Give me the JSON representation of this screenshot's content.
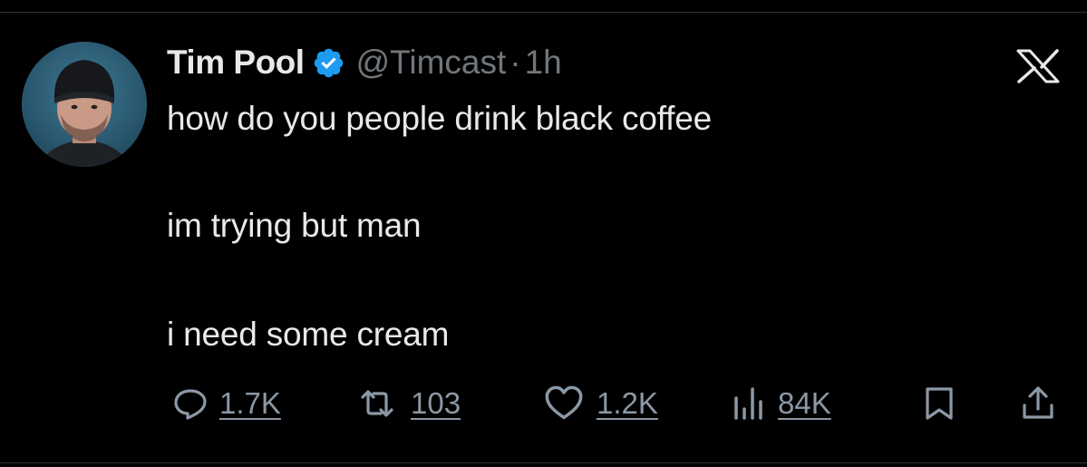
{
  "tweet": {
    "author_name": "Tim Pool",
    "handle": "@Timcast",
    "separator": "·",
    "time": "1h",
    "lines": [
      "how do you people drink black coffee",
      "im trying but man",
      "i need some cream"
    ]
  },
  "actions": {
    "replies": "1.7K",
    "reposts": "103",
    "likes": "1.2K",
    "views": "84K"
  },
  "icons": {
    "verified": "verified-badge-icon",
    "brand": "x-logo-icon",
    "reply": "reply-icon",
    "repost": "repost-icon",
    "like": "heart-icon",
    "views": "views-icon",
    "bookmark": "bookmark-icon",
    "share": "share-icon"
  },
  "colors": {
    "background": "#000000",
    "text": "#e7e9ea",
    "muted": "#71767b",
    "verified": "#1d9bf0"
  }
}
